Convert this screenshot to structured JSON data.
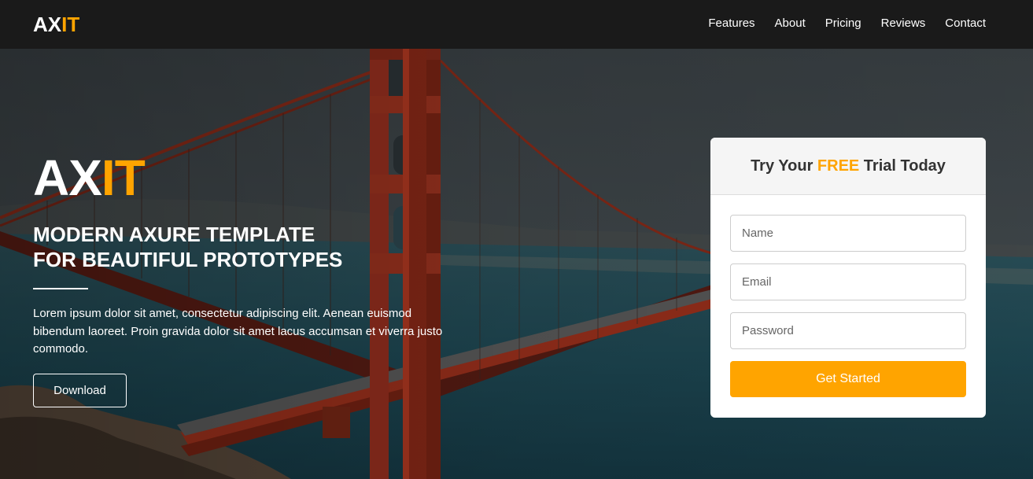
{
  "nav": {
    "logo_part1": "AX",
    "logo_part2": "IT",
    "links": [
      "Features",
      "About",
      "Pricing",
      "Reviews",
      "Contact"
    ]
  },
  "hero": {
    "brand_part1": "AX",
    "brand_part2": "IT",
    "headline_line1": "MODERN AXURE TEMPLATE",
    "headline_line2": "FOR BEAUTIFUL PROTOTYPES",
    "description": "Lorem ipsum dolor sit amet, consectetur adipiscing elit. Aenean euismod bibendum laoreet. Proin gravida dolor sit amet lacus accumsan et viverra justo commodo.",
    "download_label": "Download"
  },
  "signup": {
    "title_before": "Try Your ",
    "title_highlight": "FREE",
    "title_after": " Trial Today",
    "name_placeholder": "Name",
    "email_placeholder": "Email",
    "password_placeholder": "Password",
    "submit_label": "Get Started"
  },
  "colors": {
    "accent": "#ffa400",
    "nav_bg": "#1a1a1a",
    "bridge": "#b13a22"
  }
}
